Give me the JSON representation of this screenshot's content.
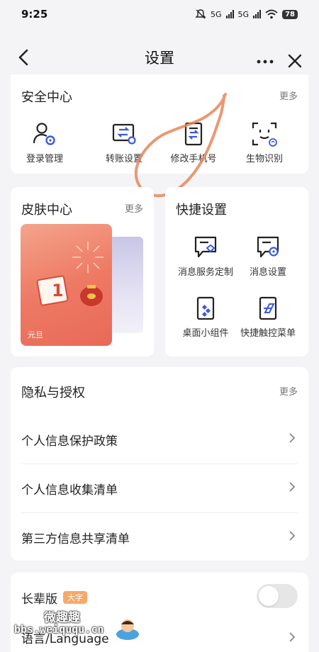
{
  "status_bar": {
    "time": "9:25",
    "net1": "5G",
    "net2": "5G",
    "battery": "78"
  },
  "header": {
    "title": "设置"
  },
  "security": {
    "title": "安全中心",
    "more": "更多",
    "items": [
      {
        "label": "登录管理",
        "icon": "user-gear-icon"
      },
      {
        "label": "转账设置",
        "icon": "transfer-icon"
      },
      {
        "label": "修改手机号",
        "icon": "phone-edit-icon"
      },
      {
        "label": "生物识别",
        "icon": "face-scan-icon"
      }
    ]
  },
  "skin": {
    "title": "皮肤中心",
    "more": "更多",
    "theme_label": "元旦",
    "calendar_day": "1"
  },
  "shortcut": {
    "title": "快捷设置",
    "items": [
      {
        "label": "消息服务定制",
        "icon": "message-heart-icon"
      },
      {
        "label": "消息设置",
        "icon": "message-gear-icon"
      },
      {
        "label": "桌面小组件",
        "icon": "widget-icon"
      },
      {
        "label": "快捷触控菜单",
        "icon": "touch-menu-icon"
      }
    ]
  },
  "privacy": {
    "title": "隐私与授权",
    "more": "更多",
    "rows": [
      {
        "label": "个人信息保护政策"
      },
      {
        "label": "个人信息收集清单"
      },
      {
        "label": "第三方信息共享清单"
      }
    ]
  },
  "elder": {
    "label": "长辈版",
    "tag": "大字",
    "enabled": false
  },
  "language": {
    "label": "语言/Language"
  },
  "watermark": {
    "line1": "微趣趣",
    "line2": "bbs.weiququ.cn"
  },
  "colors": {
    "accent": "#3b5bdb",
    "tag": "#f7a96a",
    "annotation": "#e8865a"
  }
}
